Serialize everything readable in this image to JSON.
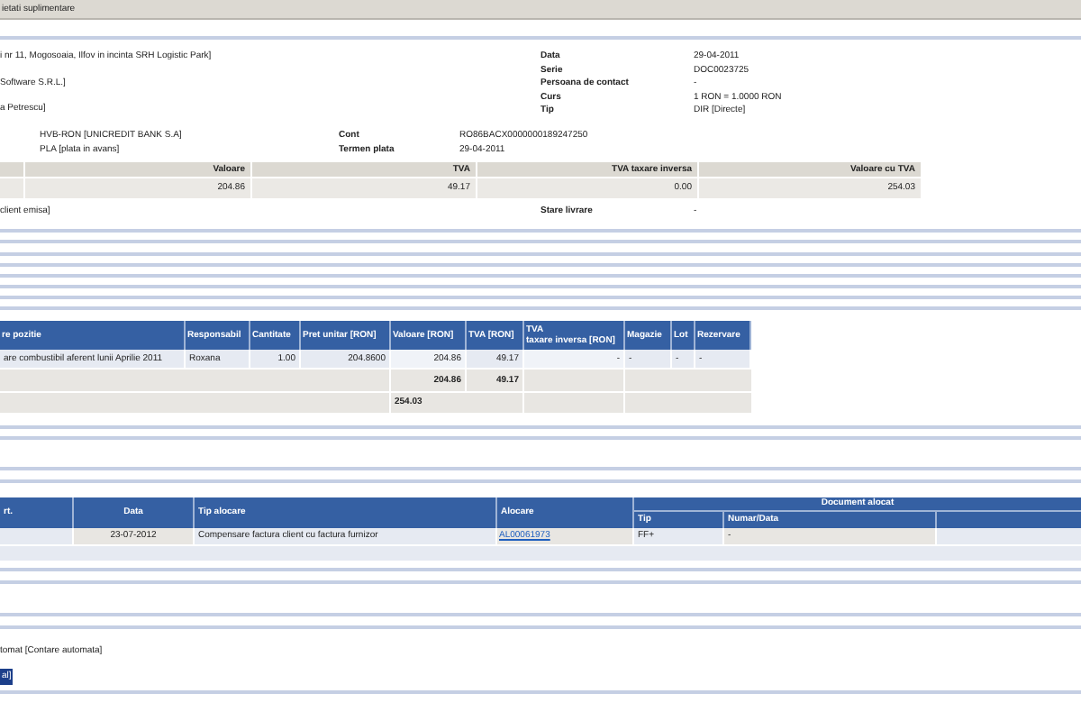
{
  "tab_bar": {
    "tab": "ietati suplimentare"
  },
  "address_lines": [
    "i nr 11, Mogosoaia, Ilfov in incinta SRH Logistic Park]",
    "Software S.R.L.]",
    "a Petrescu]"
  ],
  "header_fields": [
    {
      "label": "Data",
      "value": "29-04-2011"
    },
    {
      "label": "Serie",
      "value": "DOC0023725"
    },
    {
      "label": "Persoana de contact",
      "value": "-"
    },
    {
      "label": "Curs",
      "value": "1 RON =  1.0000 RON"
    },
    {
      "label": "Tip",
      "value": "DIR [Directe]"
    }
  ],
  "bank_rows": [
    {
      "left": "HVB-RON [UNICREDIT BANK S.A]",
      "label": "Cont",
      "value": "RO86BACX0000000189247250"
    },
    {
      "left": "PLA [plata in avans]",
      "label": "Termen plata",
      "value": "29-04-2011"
    }
  ],
  "totals_table": {
    "columns": [
      "Valoare",
      "TVA",
      "TVA taxare inversa",
      "Valoare cu TVA"
    ],
    "row": [
      "204.86",
      "49.17",
      "0.00",
      "254.03"
    ]
  },
  "delivery": {
    "left": "client emisa]",
    "label": "Stare livrare",
    "value": "-"
  },
  "positions_table": {
    "columns": [
      "re pozitie",
      "Responsabil",
      "Cantitate",
      "Pret unitar [RON]",
      "Valoare [RON]",
      "TVA [RON]",
      "TVA\ntaxare inversa [RON]",
      "Magazie",
      "Lot",
      "Rezervare"
    ],
    "row": [
      "are combustibil aferent lunii Aprilie 2011",
      "Roxana",
      "1.00",
      "204.8600",
      "204.86",
      "49.17",
      "-",
      "-",
      "-",
      "-"
    ],
    "subtotals": [
      "204.86",
      "49.17"
    ],
    "total": "254.03"
  },
  "allocation_table": {
    "columns": [
      "rt.",
      "Data",
      "Tip alocare",
      "Alocare"
    ],
    "group_header": "Document alocat",
    "sub_columns": [
      "Tip",
      "Numar/Data"
    ],
    "row": {
      "data": "23-07-2012",
      "tip_alocare": "Compensare factura client cu factura furnizor",
      "alocare": "AL00061973",
      "tip": "FF+",
      "numar_data": "-"
    }
  },
  "footer": {
    "accounting": "tomat [Contare automata]",
    "selected_text": "al]"
  }
}
